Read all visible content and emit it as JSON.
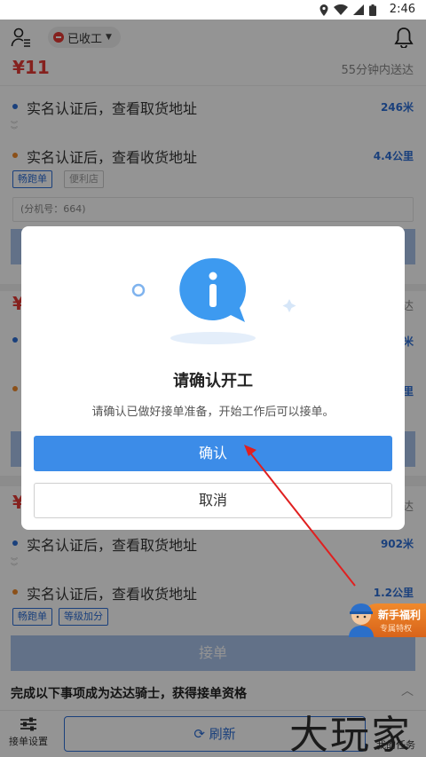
{
  "status_bar": {
    "time": "2:46"
  },
  "header": {
    "status_pill": "已收工",
    "user_icon": "user-menu-icon",
    "bell_icon": "bell-icon"
  },
  "orders": [
    {
      "price": "¥11",
      "eta": "55分钟内送达",
      "pickup": {
        "text": "实名认证后，查看取货地址",
        "distance": "246米"
      },
      "dropoff": {
        "text": "实名认证后，查看收货地址",
        "distance": "4.4公里"
      },
      "tags": [
        "畅跑单",
        "便利店"
      ],
      "extension": "(分机号：664)"
    },
    {
      "price": "¥",
      "eta": "达",
      "pickup_distance": "米",
      "dropoff_distance": "里"
    },
    {
      "price": "¥",
      "eta": "达",
      "pickup": {
        "text": "实名认证后，查看取货地址",
        "distance": "902米"
      },
      "dropoff": {
        "text": "实名认证后，查看收货地址",
        "distance": "1.2公里"
      },
      "tags": [
        "畅跑单",
        "等级加分"
      ],
      "accept_label": "接单"
    }
  ],
  "dialog": {
    "title": "请确认开工",
    "message": "请确认已做好接单准备，开始工作后可以接单。",
    "confirm_label": "确认",
    "cancel_label": "取消",
    "illustration_icon": "info-bubble-icon"
  },
  "promo": {
    "title": "新手福利",
    "subtitle": "专属特权"
  },
  "bottom_sheet": {
    "text": "完成以下事项成为达达骑士，获得接单资格"
  },
  "bottom_bar": {
    "settings_label": "接单设置",
    "refresh_label": "刷新",
    "tasks_label": "我的任务"
  },
  "watermark": "大玩家",
  "colors": {
    "accent": "#3c8ce8",
    "price": "#e53935",
    "link": "#2e6fd6",
    "promo": "#f08a2c"
  }
}
